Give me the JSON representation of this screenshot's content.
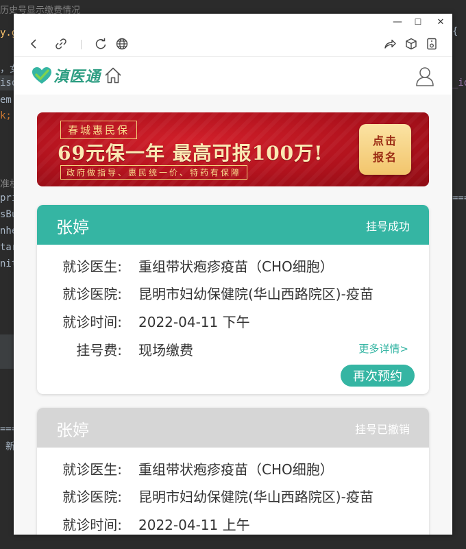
{
  "background_ide": {
    "lines": [
      "历史号显示缴费情况",
      "y.g",
      "，女",
      "iso",
      "em.",
      "k;",
      "准机",
      "pri",
      "sBu",
      "nhe",
      "tar",
      "nit",
      "====",
      "新"
    ],
    "right": [
      "{",
      "_id",
      "===="
    ]
  },
  "window_controls": {
    "minimize": "—",
    "maximize": "☐",
    "close": "✕"
  },
  "site": {
    "logo_text": "滇医通"
  },
  "banner": {
    "tag": "春城惠民保",
    "headline": "69元保一年 最高可报100万!",
    "sub": "政府做指导、惠民统一价、特药有保障",
    "cta_line1": "点击",
    "cta_line2": "报名"
  },
  "appointments": [
    {
      "patient": "张婷",
      "status": "挂号成功",
      "doctor_label": "就诊医生:",
      "doctor": "重组带状疱疹疫苗（CHO细胞）",
      "hospital_label": "就诊医院:",
      "hospital": "昆明市妇幼保健院(华山西路院区)-疫苗",
      "time_label": "就诊时间:",
      "time": "2022-04-11 下午",
      "fee_label": "挂号费:",
      "fee": "现场缴费",
      "more": "更多详情>",
      "rebook": "再次预约",
      "header_color": "#35b5a3"
    },
    {
      "patient": "张婷",
      "status": "挂号已撤销",
      "doctor_label": "就诊医生:",
      "doctor": "重组带状疱疹疫苗（CHO细胞）",
      "hospital_label": "就诊医院:",
      "hospital": "昆明市妇幼保健院(华山西路院区)-疫苗",
      "time_label": "就诊时间:",
      "time": "2022-04-11 上午",
      "header_color": "#d6d6d6"
    }
  ]
}
